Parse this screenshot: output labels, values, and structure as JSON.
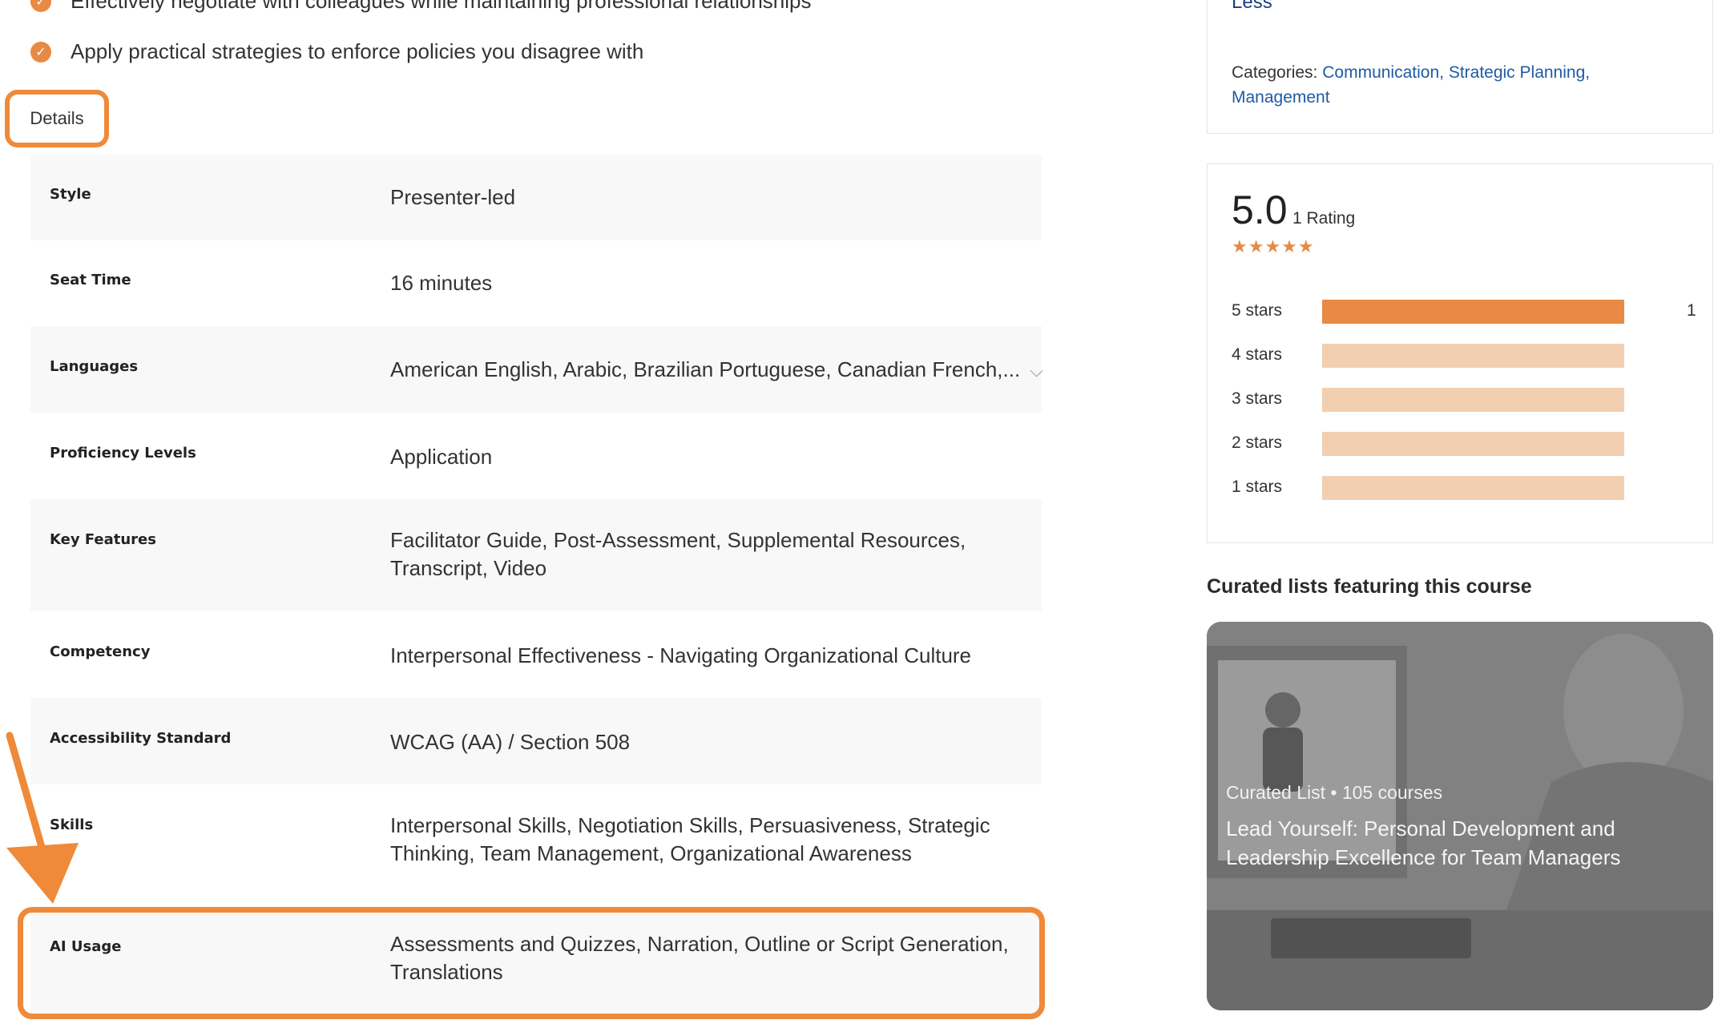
{
  "objectives": [
    "Effectively negotiate with colleagues while maintaining professional relationships",
    "Apply practical strategies to enforce policies you disagree with"
  ],
  "details_tab": {
    "label": "Details"
  },
  "details": [
    {
      "label": "Style",
      "value": "Presenter-led"
    },
    {
      "label": "Seat Time",
      "value": "16 minutes"
    },
    {
      "label": "Languages",
      "value": "American English, Arabic, Brazilian Portuguese, Canadian French,..."
    },
    {
      "label": "Proficiency Levels",
      "value": "Application"
    },
    {
      "label": "Key Features",
      "value": "Facilitator Guide, Post-Assessment, Supplemental Resources, Transcript, Video"
    },
    {
      "label": "Competency",
      "value": "Interpersonal Effectiveness - Navigating Organizational Culture"
    },
    {
      "label": "Accessibility Standard",
      "value": "WCAG (AA) / Section 508"
    },
    {
      "label": "Skills",
      "value": "Interpersonal Skills, Negotiation Skills, Persuasiveness, Strategic Thinking, Team Management, Organizational Awareness"
    },
    {
      "label": "AI Usage",
      "value": "Assessments and Quizzes, Narration, Outline or Script Generation, Translations"
    }
  ],
  "sidebar": {
    "less_link": "Less",
    "categories_label": "Categories:",
    "categories": [
      "Communication,",
      "Strategic Planning,",
      "Management"
    ]
  },
  "ratings": {
    "average": "5.0",
    "count_text": "1 Rating",
    "stars": "★★★★★",
    "histogram": [
      {
        "label": "5 stars",
        "fraction": 1.0,
        "count": "1"
      },
      {
        "label": "4 stars",
        "fraction": 0,
        "count": ""
      },
      {
        "label": "3 stars",
        "fraction": 0,
        "count": ""
      },
      {
        "label": "2 stars",
        "fraction": 0,
        "count": ""
      },
      {
        "label": "1 stars",
        "fraction": 0,
        "count": ""
      }
    ]
  },
  "curated": {
    "heading": "Curated lists featuring this course",
    "meta": "Curated List • 105 courses",
    "title": "Lead Yourself: Personal Development and Leadership Excellence for Team Managers"
  },
  "colors": {
    "accent": "#ee8a3a",
    "bar_full": "#e88a44",
    "bar_empty": "#f2cfb0",
    "link": "#1f5aa6"
  }
}
